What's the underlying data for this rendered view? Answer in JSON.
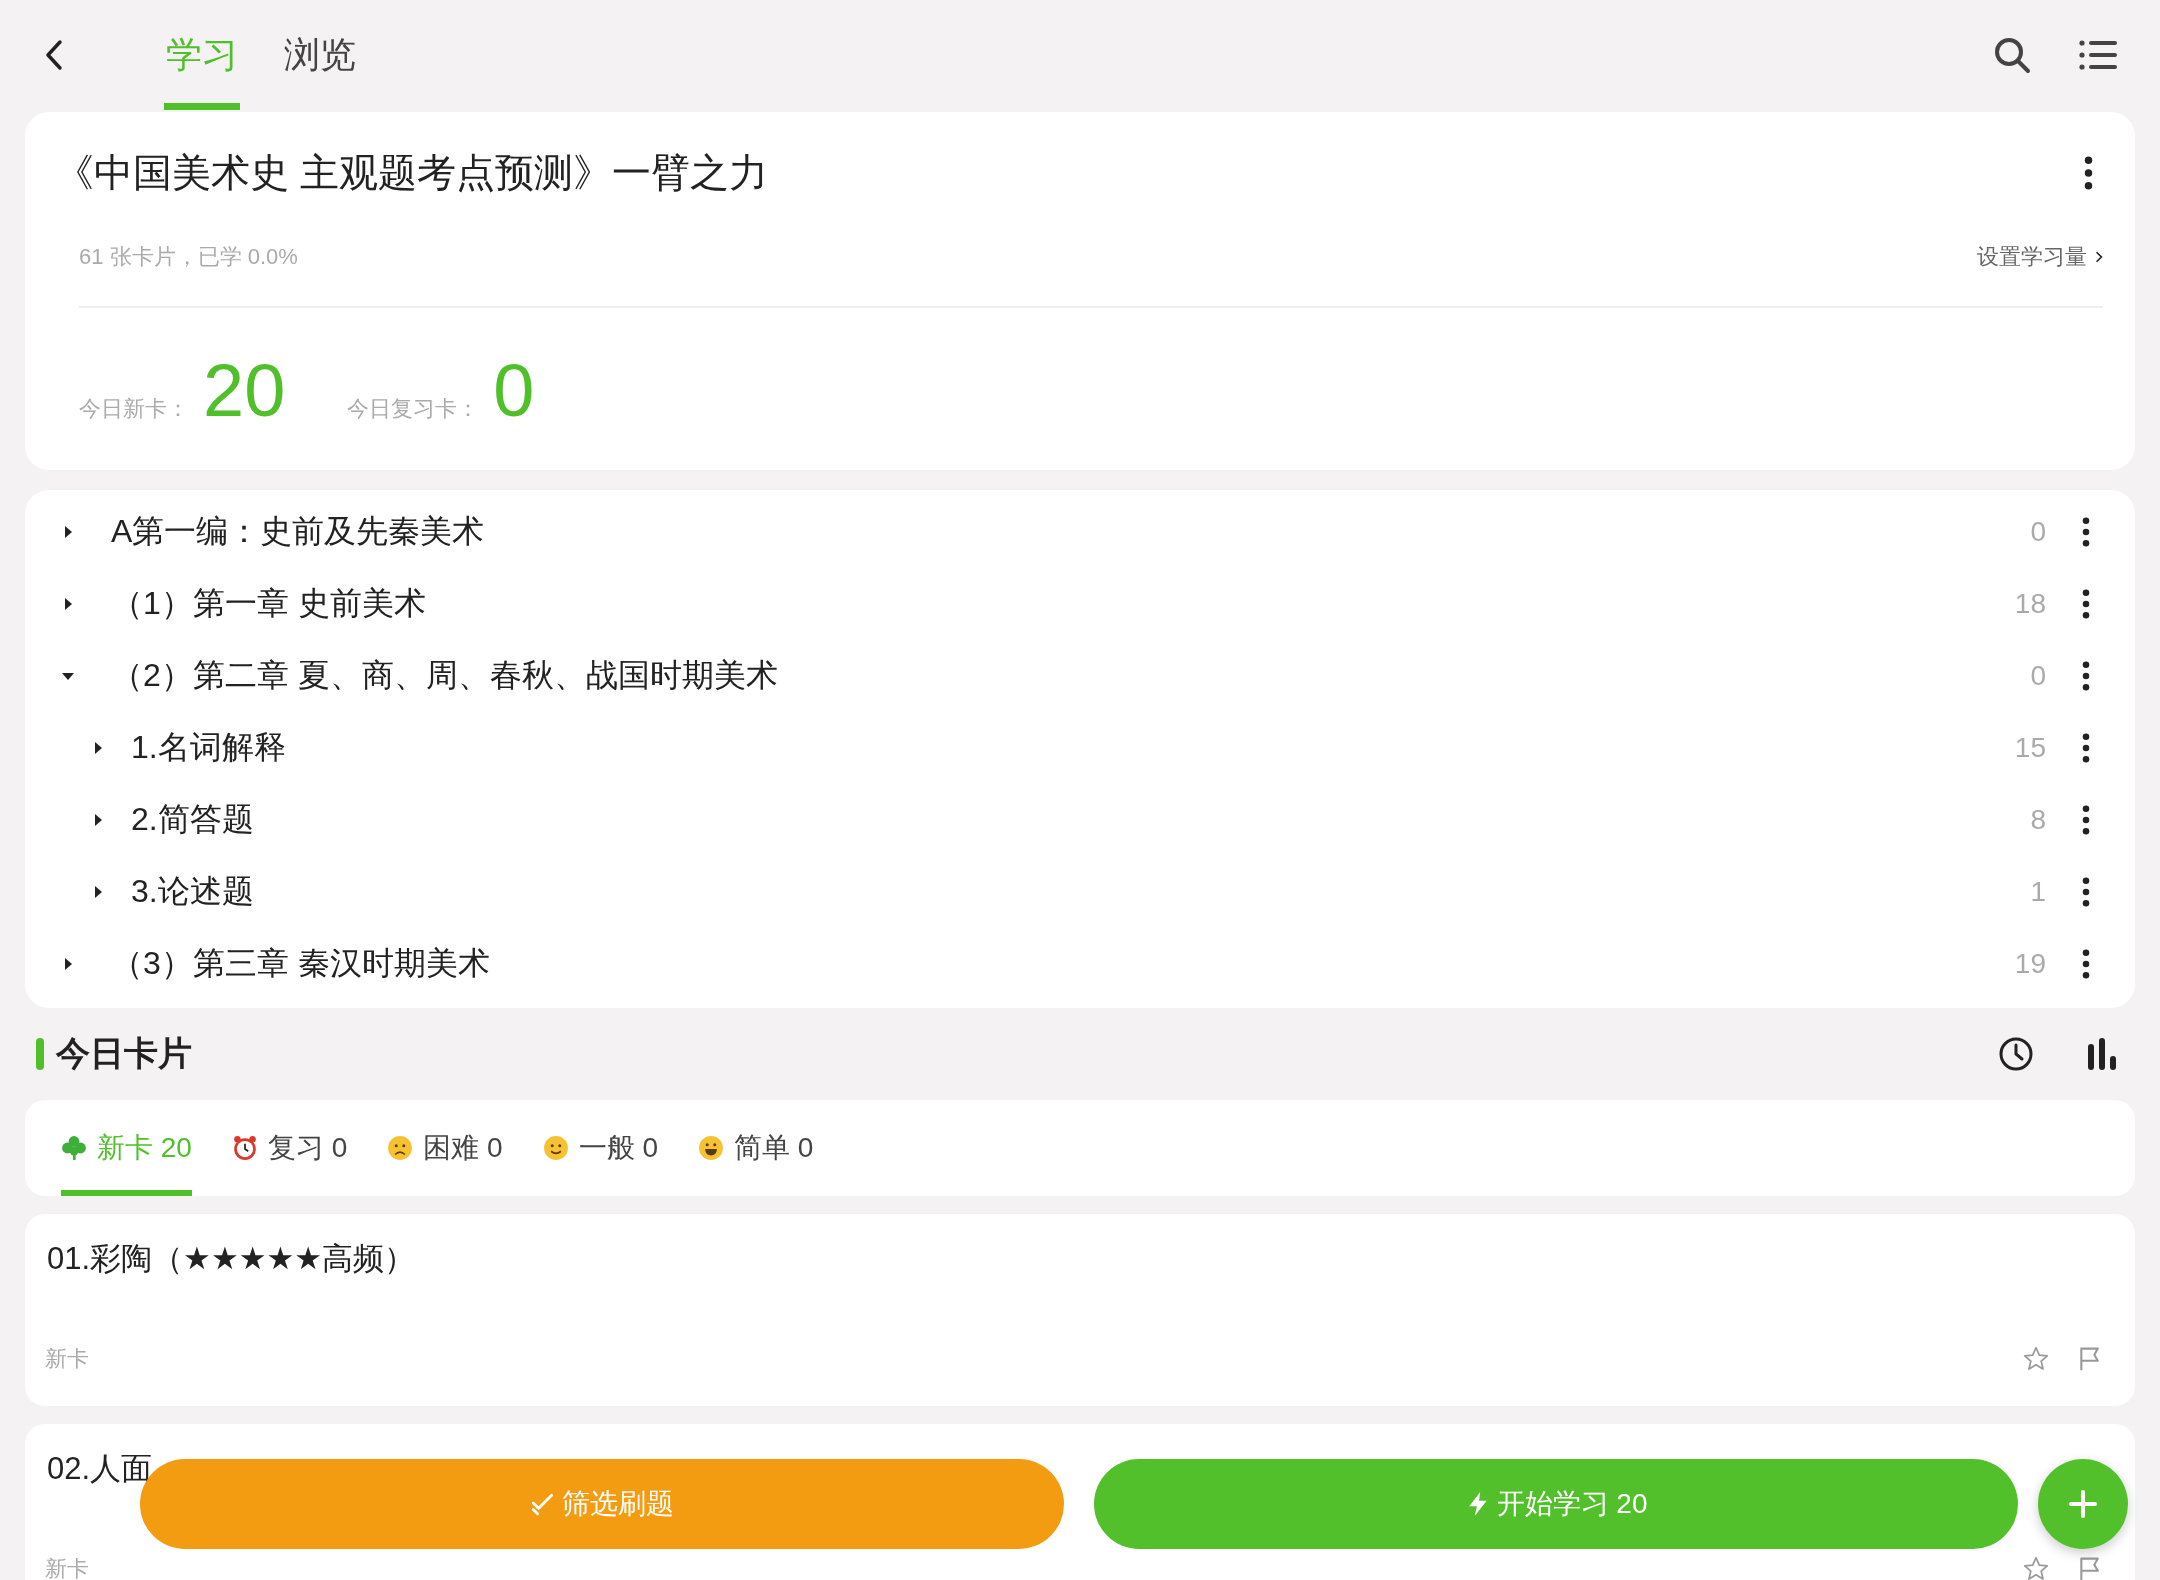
{
  "header": {
    "tabs": [
      {
        "label": "学习",
        "selected": true
      },
      {
        "label": "浏览",
        "selected": false
      }
    ]
  },
  "deck": {
    "title": "《中国美术史 主观题考点预测》一臂之力",
    "summary": "61 张卡片，已学 0.0%",
    "settings_link": "设置学习量",
    "stats": [
      {
        "label": "今日新卡：",
        "value": "20"
      },
      {
        "label": "今日复习卡：",
        "value": "0"
      }
    ]
  },
  "tree": [
    {
      "label": "A第一编：史前及先秦美术",
      "count": "0",
      "expanded": false
    },
    {
      "label": "（1）第一章 史前美术",
      "count": "18",
      "expanded": false
    },
    {
      "label": "（2）第二章 夏、商、周、春秋、战国时期美术",
      "count": "0",
      "expanded": true,
      "children": [
        {
          "label": "1.名词解释",
          "count": "15",
          "expanded": false
        },
        {
          "label": "2.简答题",
          "count": "8",
          "expanded": false
        },
        {
          "label": "3.论述题",
          "count": "1",
          "expanded": false
        }
      ]
    },
    {
      "label": "（3）第三章 秦汉时期美术",
      "count": "19",
      "expanded": false
    }
  ],
  "today": {
    "title": "今日卡片",
    "tabs": [
      {
        "kind": "new",
        "label": "新卡 20",
        "selected": true
      },
      {
        "kind": "review",
        "label": "复习 0",
        "selected": false
      },
      {
        "kind": "hard",
        "label": "困难 0",
        "selected": false
      },
      {
        "kind": "normal",
        "label": "一般 0",
        "selected": false
      },
      {
        "kind": "easy",
        "label": "简单 0",
        "selected": false
      }
    ],
    "cards": [
      {
        "title": "01.彩陶（★★★★★高频）",
        "status": "新卡"
      },
      {
        "title": "02.人面",
        "status": "新卡"
      }
    ]
  },
  "actions": {
    "filter": "筛选刷题",
    "start": "开始学习 20"
  }
}
